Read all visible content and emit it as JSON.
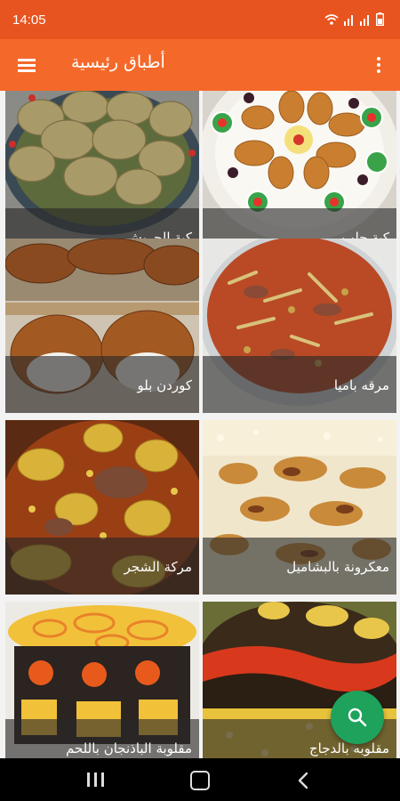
{
  "status_bar": {
    "time": "14:05",
    "icons": [
      "wifi-icon",
      "signal-icon",
      "signal-icon",
      "battery-icon"
    ]
  },
  "app_bar": {
    "title": "أطباق رئيسية",
    "menu_icon": "menu-icon",
    "more_icon": "more-vert-icon"
  },
  "dishes": [
    {
      "name": "كبة حلب"
    },
    {
      "name": "كبة الجريش"
    },
    {
      "name": "مرقه باميا"
    },
    {
      "name": "كوردن بلو"
    },
    {
      "name": "معكرونة بالبشاميل"
    },
    {
      "name": "مركة الشجر"
    },
    {
      "name": "مقلوبه بالدجاج"
    },
    {
      "name": "مقلوبة الباذنجان باللحم"
    }
  ],
  "fab": {
    "icon": "search-icon"
  },
  "nav_bar": {
    "icons": [
      "recents-icon",
      "home-icon",
      "back-icon"
    ]
  },
  "colors": {
    "status_bar": "#e8541f",
    "app_bar": "#f4692a",
    "fab": "#1ea25c"
  }
}
